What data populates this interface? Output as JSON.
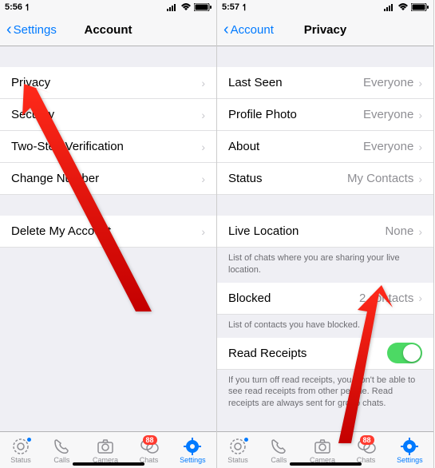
{
  "left": {
    "status": {
      "time": "5:56",
      "loc": "↿"
    },
    "nav": {
      "back": "Settings",
      "title": "Account"
    },
    "rows": [
      {
        "label": "Privacy"
      },
      {
        "label": "Security"
      },
      {
        "label": "Two-Step Verification"
      },
      {
        "label": "Change Number"
      },
      {
        "label": "Delete My Account"
      }
    ],
    "tabs": {
      "status": "Status",
      "calls": "Calls",
      "camera": "Camera",
      "chats": "Chats",
      "settings": "Settings",
      "chats_badge": "88"
    }
  },
  "right": {
    "status": {
      "time": "5:57",
      "loc": "↿"
    },
    "nav": {
      "back": "Account",
      "title": "Privacy"
    },
    "g1": [
      {
        "label": "Last Seen",
        "value": "Everyone"
      },
      {
        "label": "Profile Photo",
        "value": "Everyone"
      },
      {
        "label": "About",
        "value": "Everyone"
      },
      {
        "label": "Status",
        "value": "My Contacts"
      }
    ],
    "live": {
      "label": "Live Location",
      "value": "None",
      "note": "List of chats where you are sharing your live location."
    },
    "blocked": {
      "label": "Blocked",
      "value": "2 contacts",
      "note": "List of contacts you have blocked."
    },
    "read": {
      "label": "Read Receipts",
      "note": "If you turn off read receipts, you won't be able to see read receipts from other people. Read receipts are always sent for group chats."
    },
    "tabs": {
      "status": "Status",
      "calls": "Calls",
      "camera": "Camera",
      "chats": "Chats",
      "settings": "Settings",
      "chats_badge": "88"
    }
  }
}
